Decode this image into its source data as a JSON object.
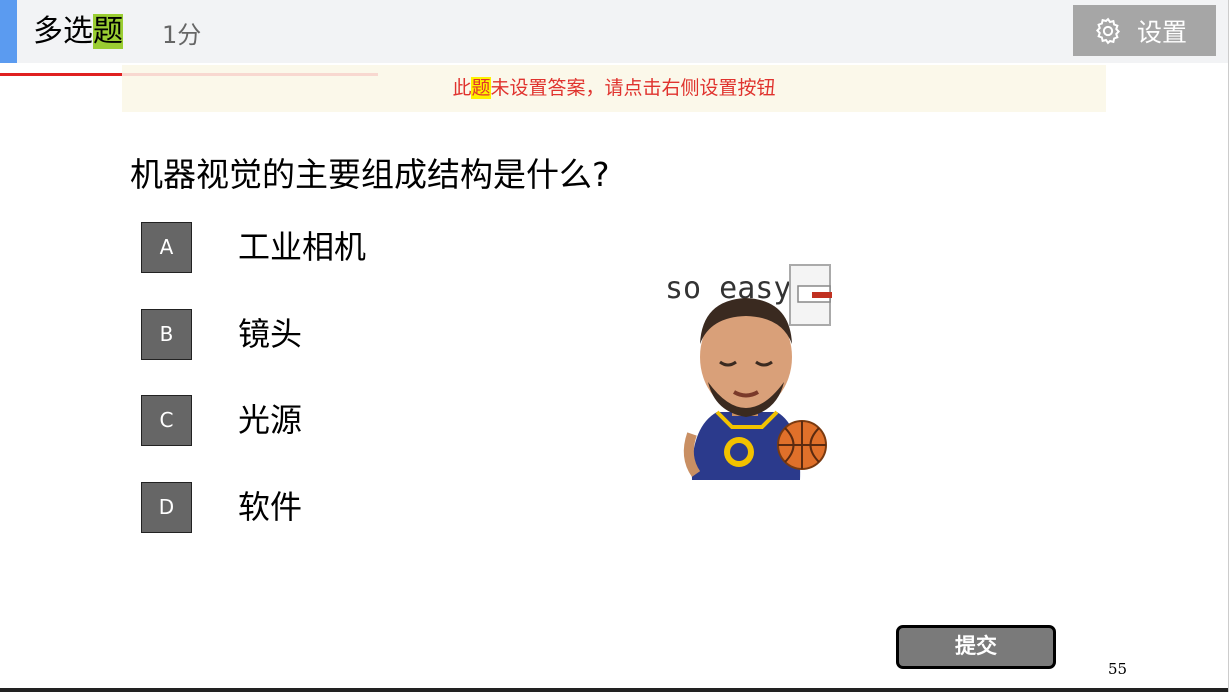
{
  "header": {
    "question_type_prefix": "多选",
    "question_type_highlight": "题",
    "score": "1分",
    "settings_label": "设置",
    "settings_icon": "gear-icon"
  },
  "notice": {
    "part1": "此",
    "part_highlight": "题",
    "part2": "未设置答案，请点击右侧设置按钮"
  },
  "question": {
    "text": "机器视觉的主要组成结构是什么?"
  },
  "options": [
    {
      "letter": "A",
      "text": "工业相机"
    },
    {
      "letter": "B",
      "text": "镜头"
    },
    {
      "letter": "C",
      "text": "光源"
    },
    {
      "letter": "D",
      "text": "软件"
    }
  ],
  "illustration": {
    "caption": "so easy"
  },
  "submit_label": "提交",
  "page_number": "55",
  "colors": {
    "accent_blue": "#5b9bf0",
    "notice_red": "#e0332e",
    "highlight_green": "#9acd32",
    "highlight_yellow": "#fff200",
    "option_gray": "#666666"
  }
}
